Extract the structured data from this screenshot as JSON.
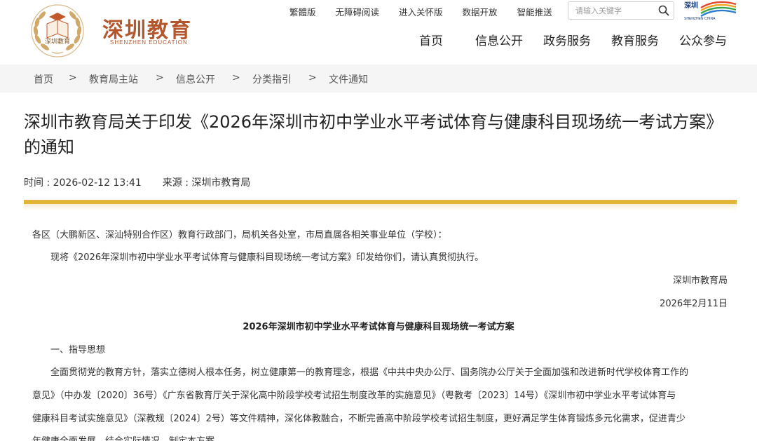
{
  "header": {
    "logo_title": "深圳教育",
    "logo_sub": "SHENZHEN EDUCATION",
    "emblem_text": "深圳教育",
    "toplinks": [
      "繁體版",
      "无障碍阅读",
      "进入关怀版",
      "数据开放",
      "智能推送"
    ],
    "search_placeholder": "请输入关键字",
    "brand_mark_text": "深圳",
    "brand_mark_sub": "SHENZHEN CHINA",
    "nav": [
      "首页",
      "信息公开",
      "政务服务",
      "教育服务",
      "公众参与"
    ]
  },
  "breadcrumb": {
    "items": [
      "首页",
      "教育局主站",
      "信息公开",
      "分类指引",
      "文件通知"
    ],
    "separator": ">"
  },
  "article": {
    "title": "深圳市教育局关于印发《2026年深圳市初中学业水平考试体育与健康科目现场统一考试方案》的通知",
    "time_label": "时间 : 2026-02-12 13:41",
    "source_label": "来源 : 深圳市教育局",
    "paragraphs": [
      "各区（大鹏新区、深汕特别合作区）教育行政部门，局机关各处室，市局直属各相关事业单位（学校）：",
      "现将《2026年深圳市初中学业水平考试体育与健康科目现场统一考试方案》印发给你们，请认真贯彻执行。",
      "深圳市教育局",
      "2026年2月11日",
      "2026年深圳市初中学业水平考试体育与健康科目现场统一考试方案",
      "一、指导思想",
      "全面贯彻党的教育方针，落实立德树人根本任务，树立健康第一的教育理念，根据《中共中央办公厅、国务院办公厅关于全面加强和改进新时代学校体育工作的",
      "意见》（中办发〔2020〕36号）《广东省教育厅关于深化高中阶段学校考试招生制度改革的实施意见》（粤教考〔2023〕14号）《深圳市初中学业水平考试体育与",
      "健康科目考试实施意见》（深教规〔2024〕2号）等文件精神，深化体教融合，不断完善高中阶段学校考试招生制度，更好满足学生体育锻炼多元化需求，促进青少",
      "年健康全面发展，结合实际情况，制定本方案。"
    ]
  },
  "colors": {
    "brand": "#b5572c",
    "accent_gold": "#e3b43a",
    "crumb_bg": "#f5f5f5"
  }
}
